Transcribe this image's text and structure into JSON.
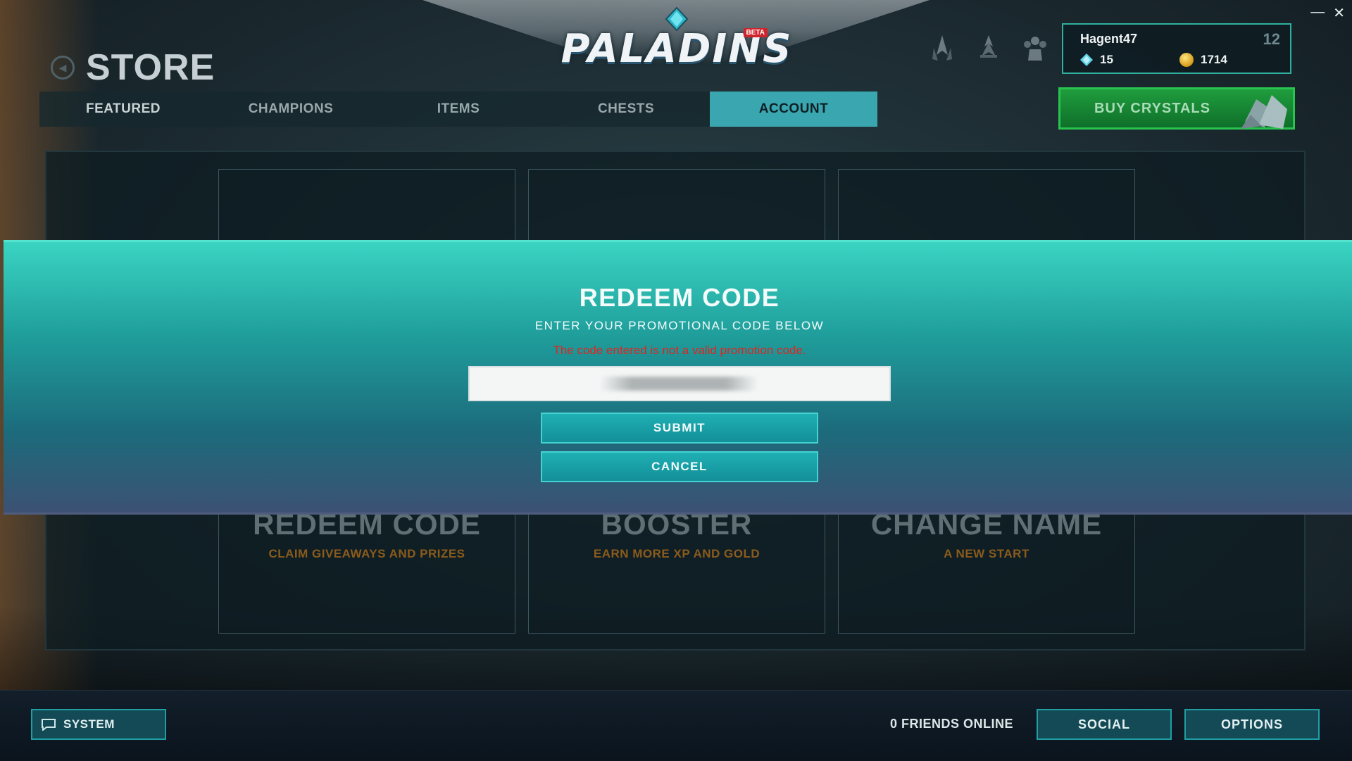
{
  "header": {
    "page_title": "STORE",
    "logo_text": "PALADINS",
    "logo_badge": "BETA"
  },
  "tabs": [
    {
      "label": "FEATURED"
    },
    {
      "label": "CHAMPIONS"
    },
    {
      "label": "ITEMS"
    },
    {
      "label": "CHESTS"
    },
    {
      "label": "ACCOUNT",
      "active": true
    }
  ],
  "user": {
    "name": "Hagent47",
    "level": "12",
    "crystals": "15",
    "gold": "1714"
  },
  "buy_crystals_label": "BUY CRYSTALS",
  "cards": [
    {
      "title": "REDEEM CODE",
      "subtitle": "CLAIM GIVEAWAYS AND PRIZES"
    },
    {
      "title": "BOOSTER",
      "subtitle": "EARN MORE XP AND GOLD"
    },
    {
      "title": "CHANGE NAME",
      "subtitle": "A NEW START"
    }
  ],
  "modal": {
    "title": "REDEEM CODE",
    "subtitle": "ENTER YOUR PROMOTIONAL CODE BELOW",
    "error": "The code entered is not a valid promotion code.",
    "submit_label": "SUBMIT",
    "cancel_label": "CANCEL"
  },
  "bottom_bar": {
    "system_label": "SYSTEM",
    "friends_online": "0 FRIENDS ONLINE",
    "social_label": "SOCIAL",
    "options_label": "OPTIONS"
  },
  "window_controls": {
    "minimize": "—",
    "close": "✕"
  },
  "colors": {
    "accent_teal": "#3aa7b0",
    "modal_teal": "#1f9d9b",
    "error_red": "#e3231e",
    "buy_green": "#1f9d3d",
    "card_subtitle_orange": "#8b5b1c"
  }
}
